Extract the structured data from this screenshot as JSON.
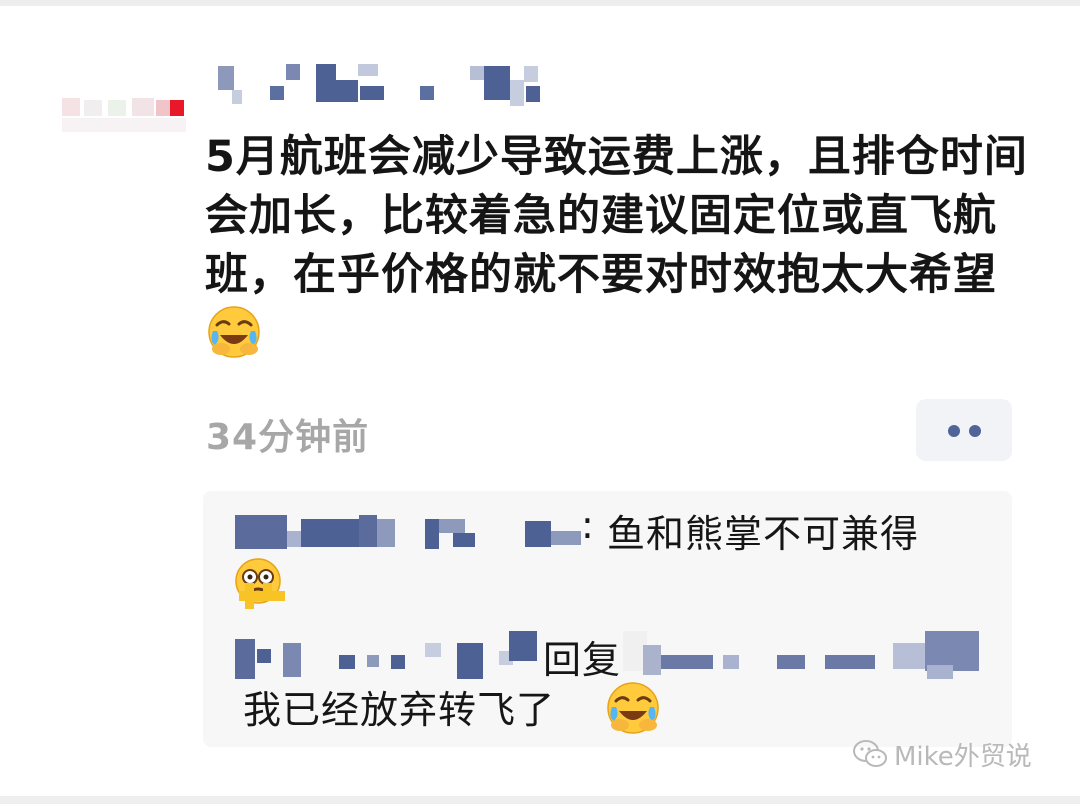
{
  "comment": {
    "text": "5月航班会减少导致运费上涨，且排仓时间会加长，比较着急的建议固定位或直飞航班，在乎价格的就不要对时效抱太大希望",
    "emoji": "crying-laughing-emoji",
    "time": "34分钟前"
  },
  "more_button": {
    "icon": "more-dots-icon"
  },
  "replies": [
    {
      "separator": ":",
      "text": "鱼和熊掌不可兼得",
      "emoji": "crying-emoji"
    },
    {
      "action": "回复",
      "text": "我已经放弃转飞了",
      "emoji": "crying-laughing-emoji"
    }
  ],
  "watermark": {
    "text": "Mike外贸说",
    "icon": "wechat-icon"
  },
  "colors": {
    "nickname": "#5b6fa0",
    "time": "#a7a7a7",
    "reply_bg": "#f7f7f7",
    "dots": "#51649a"
  }
}
